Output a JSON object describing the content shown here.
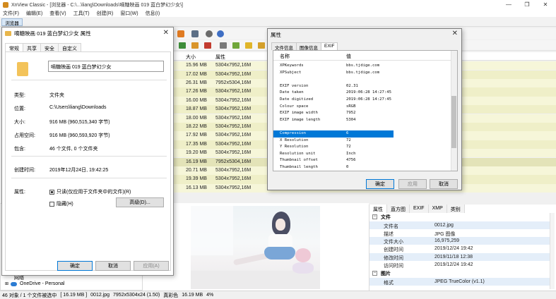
{
  "app": {
    "title": "XnView Classic - [浏览器 - C:\\...\\liang\\Downloads\\嘀糖映画 019 蓝白梦幻少女\\]",
    "menu": [
      "文件(F)",
      "编辑(E)",
      "查看(V)",
      "工具(T)",
      "创建(R)",
      "窗口(W)",
      "信息(I)"
    ],
    "browser_tab": "浏览器",
    "window_controls": {
      "minimize": "—",
      "restore": "❐",
      "close": "✕"
    }
  },
  "filelist": {
    "headers": {
      "size": "大小",
      "dims": "属性"
    },
    "rows": [
      {
        "size": "15.96 MB",
        "dims": "5304x7952,16M"
      },
      {
        "size": "17.02 MB",
        "dims": "5304x7952,16M"
      },
      {
        "size": "26.31 MB",
        "dims": "7952x5304,16M"
      },
      {
        "size": "17.26 MB",
        "dims": "5304x7952,16M"
      },
      {
        "size": "16.00 MB",
        "dims": "5304x7952,16M"
      },
      {
        "size": "18.87 MB",
        "dims": "5304x7952,16M"
      },
      {
        "size": "18.00 MB",
        "dims": "5304x7952,16M"
      },
      {
        "size": "18.22 MB",
        "dims": "5304x7952,16M"
      },
      {
        "size": "17.92 MB",
        "dims": "5304x7952,16M"
      },
      {
        "size": "17.35 MB",
        "dims": "5304x7952,16M"
      },
      {
        "size": "19.20 MB",
        "dims": "5304x7952,16M"
      },
      {
        "size": "16.19 MB",
        "dims": "7952x5304,16M"
      },
      {
        "size": "20.71 MB",
        "dims": "5304x7952,16M"
      },
      {
        "size": "19.39 MB",
        "dims": "5304x7952,16M"
      },
      {
        "size": "16.13 MB",
        "dims": "5304x7952,16M"
      }
    ]
  },
  "tree": {
    "item_partial": "网络",
    "onedrive": "OneDrive - Personal"
  },
  "props": {
    "tabs": [
      "属性",
      "直方图",
      "EXIF",
      "XMP",
      "类别"
    ],
    "file_section": "文件",
    "rows": [
      {
        "k": "文件名",
        "v": "0012.jpg"
      },
      {
        "k": "描述",
        "v": "JPG 图像"
      },
      {
        "k": "文件大小",
        "v": "16,975,259"
      },
      {
        "k": "创建时间",
        "v": "2019/12/24 19:42"
      },
      {
        "k": "修改时间",
        "v": "2019/11/18 12:38"
      },
      {
        "k": "访问时间",
        "v": "2019/12/24 19:42"
      }
    ],
    "image_section": "图片",
    "format_row": {
      "k": "格式",
      "v": "JPEG TrueColor (v1.1)"
    }
  },
  "statusbar": {
    "count": "46 对象 / 1 个文件被选中",
    "size": "[ 16.19 MB ]",
    "file": "0012.jpg",
    "info": "7952x5304x24 (1.50)",
    "color": "真彩色",
    "mem": "16.19 MB",
    "zoom": "4%"
  },
  "win_props": {
    "title": "嘀糖映画 019 蓝白梦幻少女 属性",
    "tabs": [
      "常规",
      "共享",
      "安全",
      "自定义"
    ],
    "name_value": "嘀糖映画 019 蓝白梦幻少女",
    "rows": [
      {
        "k": "类型:",
        "v": "文件夹"
      },
      {
        "k": "位置:",
        "v": "C:\\Users\\liang\\Downloads"
      },
      {
        "k": "大小:",
        "v": "916 MB (960,515,340 字节)"
      },
      {
        "k": "占用空间:",
        "v": "916 MB (960,593,920 字节)"
      },
      {
        "k": "包含:",
        "v": "46 个文件, 0 个文件夹"
      },
      {
        "k": "创建时间:",
        "v": "2019年12月24日, 19:42:25"
      }
    ],
    "attr_label": "属性:",
    "readonly_label": "只读(仅应用于文件夹中的文件)(R)",
    "hidden_label": "隐藏(H)",
    "advanced_button": "高级(D)...",
    "ok": "确定",
    "cancel": "取消",
    "apply": "应用(A)"
  },
  "exif_dialog": {
    "title": "属性",
    "tabs": [
      "文件信息",
      "图像信息",
      "EXIF"
    ],
    "col_name": "名称",
    "col_value": "值",
    "rows": [
      {
        "k": "XPKeywords",
        "v": "bbs.tjdige.com"
      },
      {
        "k": "XPSubject",
        "v": "bbs.tjdige.com"
      },
      {
        "k": "",
        "v": ""
      },
      {
        "k": "EXIF version",
        "v": "02.31"
      },
      {
        "k": "Date taken",
        "v": "2019:06:28 14:27:45"
      },
      {
        "k": "Date digitized",
        "v": "2019:06:28 14:27:45"
      },
      {
        "k": "Colour space",
        "v": "sRGB"
      },
      {
        "k": "EXIF image width",
        "v": "7952"
      },
      {
        "k": "EXIF image length",
        "v": "5304"
      },
      {
        "k": "",
        "v": ""
      },
      {
        "k": "Compression",
        "v": "6"
      },
      {
        "k": "X Resolution",
        "v": "72"
      },
      {
        "k": "Y Resolution",
        "v": "72"
      },
      {
        "k": "Resolution unit",
        "v": "Inch"
      },
      {
        "k": "Thumbnail offset",
        "v": "4756"
      },
      {
        "k": "Thumbnail length",
        "v": "0"
      }
    ],
    "ok": "确定",
    "apply": "应用",
    "cancel": "取消"
  }
}
